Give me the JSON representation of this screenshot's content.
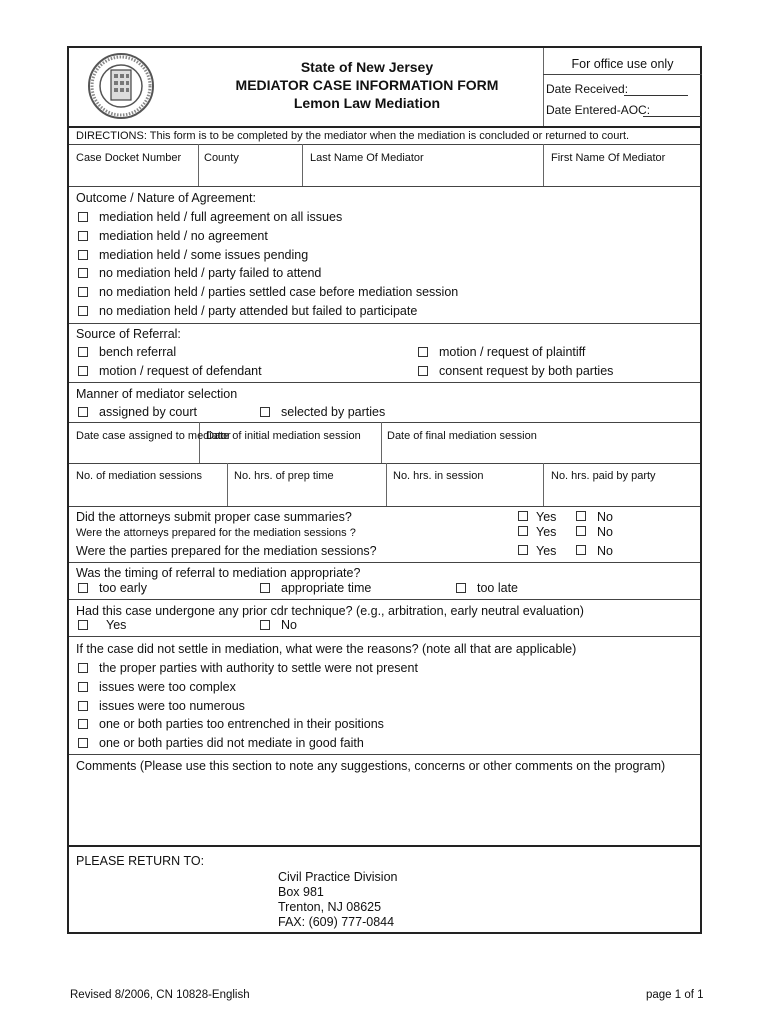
{
  "header": {
    "line1": "State of New Jersey",
    "line2": "MEDIATOR CASE INFORMATION FORM",
    "line3": "Lemon Law Mediation",
    "seal_icon": "court-seal-icon"
  },
  "office": {
    "title": "For office use only",
    "date_received": "Date Received:",
    "date_entered": "Date Entered-AOC:"
  },
  "directions": "DIRECTIONS:  This form is to be completed by the mediator when the mediation is concluded or returned to court.",
  "case_fields": [
    "Case Docket Number",
    "County",
    "Last Name Of Mediator",
    "First Name Of Mediator"
  ],
  "outcome": {
    "label": "Outcome / Nature of Agreement:",
    "options": [
      "mediation held / full agreement on all issues",
      "mediation held / no agreement",
      "mediation held / some issues pending",
      "no mediation held / party failed to attend",
      "no mediation held / parties settled case before mediation session",
      "no mediation held / party attended but failed to participate"
    ]
  },
  "referral": {
    "label": "Source of Referral:",
    "options": [
      "bench referral",
      "motion / request of plaintiff",
      "motion / request of defendant",
      "consent request by both parties"
    ]
  },
  "selection": {
    "label": "Manner of mediator selection",
    "options": [
      "assigned by court",
      "selected by parties"
    ]
  },
  "dates": [
    "Date case assigned to mediator",
    "Date of initial mediation session",
    "Date of final mediation session"
  ],
  "hours": [
    "No. of mediation sessions",
    "No. hrs. of prep time",
    "No. hrs. in session",
    "No. hrs. paid by party"
  ],
  "questions": [
    {
      "text": "Did the attorneys submit proper case summaries?",
      "yes": "Yes",
      "no": "No"
    },
    {
      "text": "Were the attorneys prepared for the mediation sessions ?",
      "yes": "Yes",
      "no": "No"
    },
    {
      "text": "Were the parties prepared for the mediation sessions?",
      "yes": "Yes",
      "no": "No"
    }
  ],
  "timing": {
    "label": "Was the timing of referral to mediation appropriate?",
    "options": [
      "too early",
      "appropriate time",
      "too late"
    ]
  },
  "prior": {
    "label": "Had this case undergone any prior cdr technique? (e.g., arbitration, early neutral evaluation)",
    "options": [
      "Yes",
      "No"
    ]
  },
  "reasons": {
    "label": "If the case did not settle in mediation, what were the reasons? (note all that are applicable)",
    "options": [
      "the proper parties with authority to settle were not present",
      "issues were too complex",
      "issues were too numerous",
      "one or both parties too entrenched in their positions",
      "one or both parties did not mediate in good faith"
    ]
  },
  "comments": {
    "label": "Comments (Please use this section to note any suggestions, concerns or other comments on the program)"
  },
  "return": {
    "label": "PLEASE RETURN TO:",
    "lines": [
      "Civil Practice Division",
      "Box 981",
      "Trenton, NJ 08625",
      "FAX: (609) 777-0844"
    ]
  },
  "footer": {
    "left": "Revised 8/2006, CN 10828-English",
    "right": "page 1 of 1"
  }
}
